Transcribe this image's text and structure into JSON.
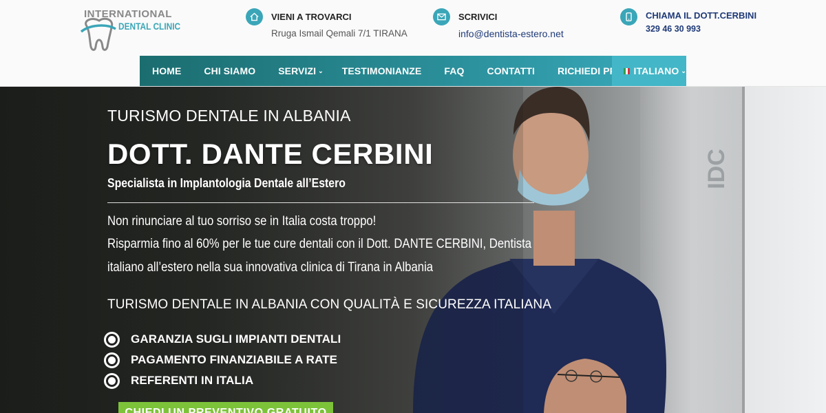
{
  "logo": {
    "line1": "INTERNATIONAL",
    "line2": "DENTAL CLINIC"
  },
  "contacts": [
    {
      "icon": "home-icon",
      "title": "VIENI A TROVARCI",
      "value": "Rruga Ismail Qemali 7/1 TIRANA"
    },
    {
      "icon": "mail-icon",
      "title": "SCRIVICI",
      "value": "info@dentista-estero.net"
    },
    {
      "icon": "phone-icon",
      "title": "CHIAMA IL DOTT.CERBINI",
      "value": "329 46 30 993"
    }
  ],
  "nav": {
    "items": [
      {
        "label": "HOME"
      },
      {
        "label": "CHI SIAMO"
      },
      {
        "label": "SERVIZI",
        "chevron": "⌄"
      },
      {
        "label": "TESTIMONIANZE"
      },
      {
        "label": "FAQ"
      },
      {
        "label": "CONTATTI"
      },
      {
        "label": "RICHIEDI PREVENTIVO"
      }
    ],
    "language": {
      "label": "ITALIANO",
      "chevron": "⌄",
      "flag": [
        "#2e9d4c",
        "#ffffff",
        "#d7303b"
      ]
    }
  },
  "hero": {
    "pretitle": "TURISMO DENTALE IN ALBANIA",
    "title": "DOTT. DANTE CERBINI",
    "subtitle": "Specialista in Implantologia Dentale all’Estero",
    "paragraph": [
      "Non rinunciare al tuo sorriso se in Italia costa troppo!",
      "Risparmia fino al 60% per le tue cure dentali con il Dott. DANTE CERBINI, Dentista",
      "italiano all’estero nella sua innovativa clinica di Tirana in Albania"
    ],
    "tagline": "TURISMO DENTALE IN ALBANIA CON QUALITÀ E SICUREZZA ITALIANA",
    "bullets": [
      "GARANZIA SUGLI IMPIANTI DENTALI",
      "PAGAMENTO FINANZIABILE A RATE",
      "REFERENTI IN ITALIA"
    ],
    "cta": "CHIEDI UN PREVENTIVO GRATUITO",
    "wall_sign": "IDC"
  },
  "colors": {
    "accent": "#3aa6b8",
    "nav_dark": "#1b6d6f",
    "cta": "#7dc33a",
    "link": "#1f3a78"
  }
}
